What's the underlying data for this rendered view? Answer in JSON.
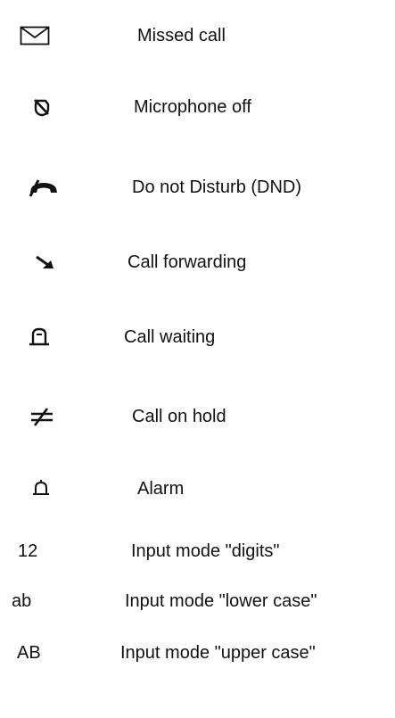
{
  "legend": {
    "items": [
      {
        "icon": "envelope-icon",
        "label": "Missed call"
      },
      {
        "icon": "microphone-off-icon",
        "label": "Microphone off"
      },
      {
        "icon": "handset-dnd-icon",
        "label": "Do not Disturb (DND)"
      },
      {
        "icon": "arrow-forward-icon",
        "label": "Call forwarding"
      },
      {
        "icon": "call-waiting-icon",
        "label": "Call waiting"
      },
      {
        "icon": "call-hold-icon",
        "label": "Call on hold"
      },
      {
        "icon": "bell-icon",
        "label": "Alarm"
      },
      {
        "code": "12",
        "label": "Input mode \"digits\""
      },
      {
        "code": "ab",
        "label": "Input mode \"lower case\""
      },
      {
        "code": "AB",
        "label": "Input mode \"upper case\""
      }
    ]
  }
}
